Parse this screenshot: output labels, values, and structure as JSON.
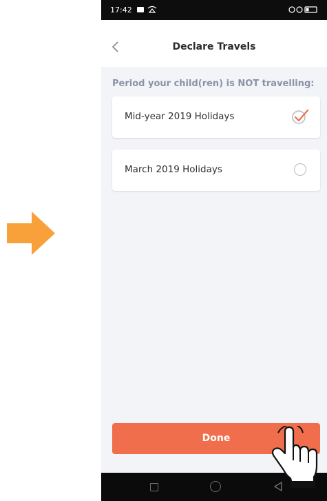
{
  "status_bar": {
    "time": "17:42"
  },
  "nav": {
    "title": "Declare Travels"
  },
  "section": {
    "label": "Period your child(ren) is NOT travelling:"
  },
  "options": [
    {
      "label": "Mid-year 2019 Holidays",
      "selected": true
    },
    {
      "label": "March 2019 Holidays",
      "selected": false
    }
  ],
  "done": {
    "label": "Done"
  },
  "colors": {
    "accent": "#f06e4b",
    "arrow": "#f8a13a",
    "background": "#f3f4f8"
  }
}
